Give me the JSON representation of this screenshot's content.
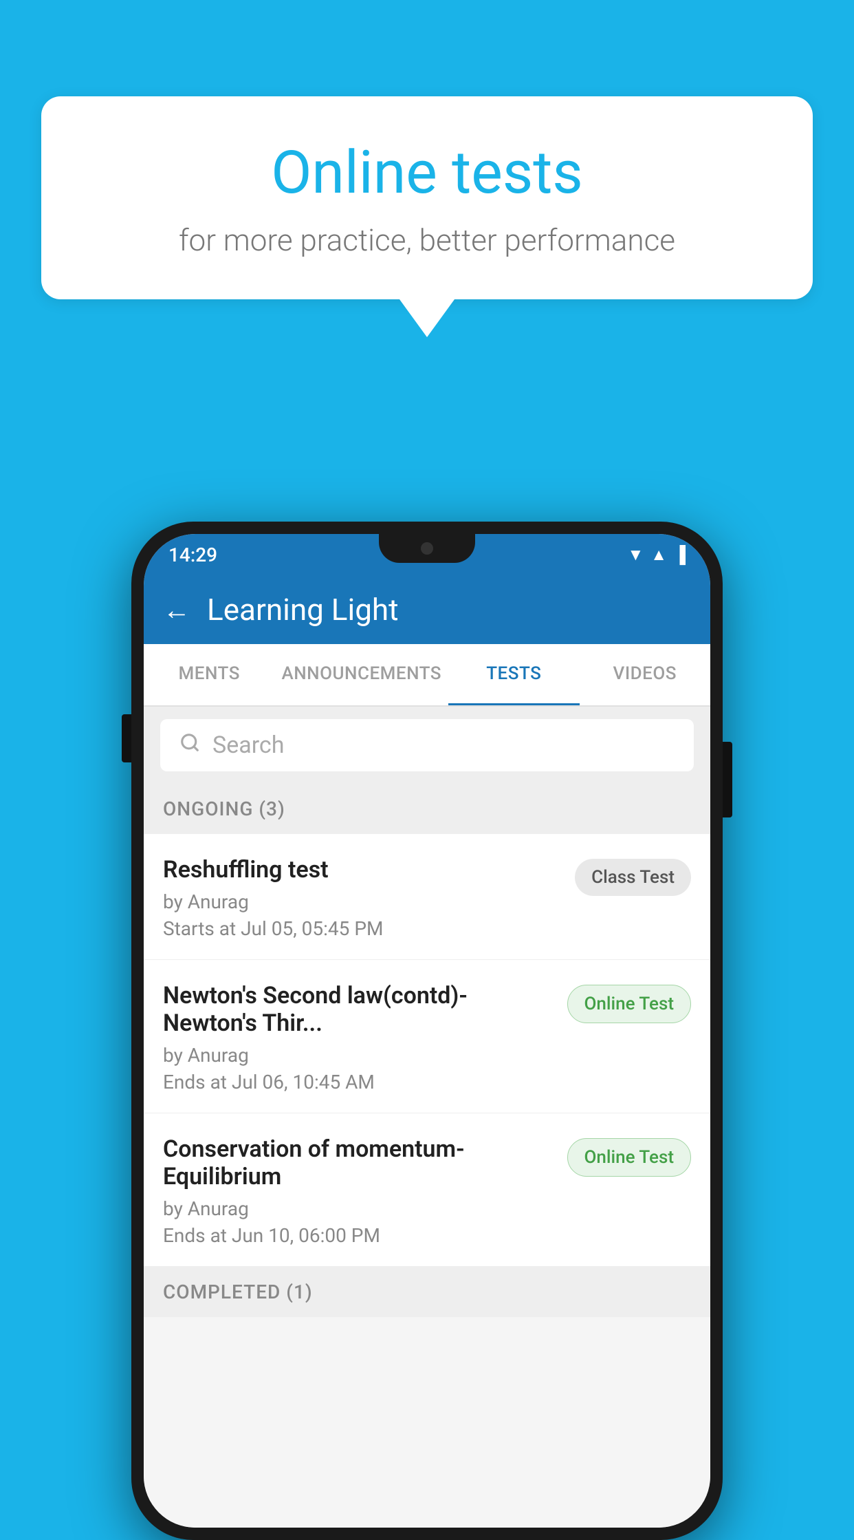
{
  "background_color": "#1ab3e8",
  "speech_bubble": {
    "title": "Online tests",
    "subtitle": "for more practice, better performance"
  },
  "phone": {
    "status_bar": {
      "time": "14:29",
      "icons": [
        "wifi",
        "signal",
        "battery"
      ]
    },
    "app_bar": {
      "title": "Learning Light",
      "back_label": "←"
    },
    "tabs": [
      {
        "label": "MENTS",
        "active": false
      },
      {
        "label": "ANNOUNCEMENTS",
        "active": false
      },
      {
        "label": "TESTS",
        "active": true
      },
      {
        "label": "VIDEOS",
        "active": false
      }
    ],
    "search": {
      "placeholder": "Search"
    },
    "sections": [
      {
        "header": "ONGOING (3)",
        "items": [
          {
            "title": "Reshuffling test",
            "author": "by Anurag",
            "date": "Starts at  Jul 05, 05:45 PM",
            "badge": "Class Test",
            "badge_type": "class"
          },
          {
            "title": "Newton's Second law(contd)-Newton's Thir...",
            "author": "by Anurag",
            "date": "Ends at  Jul 06, 10:45 AM",
            "badge": "Online Test",
            "badge_type": "online"
          },
          {
            "title": "Conservation of momentum-Equilibrium",
            "author": "by Anurag",
            "date": "Ends at  Jun 10, 06:00 PM",
            "badge": "Online Test",
            "badge_type": "online"
          }
        ]
      }
    ],
    "completed_section": {
      "header": "COMPLETED (1)"
    }
  }
}
